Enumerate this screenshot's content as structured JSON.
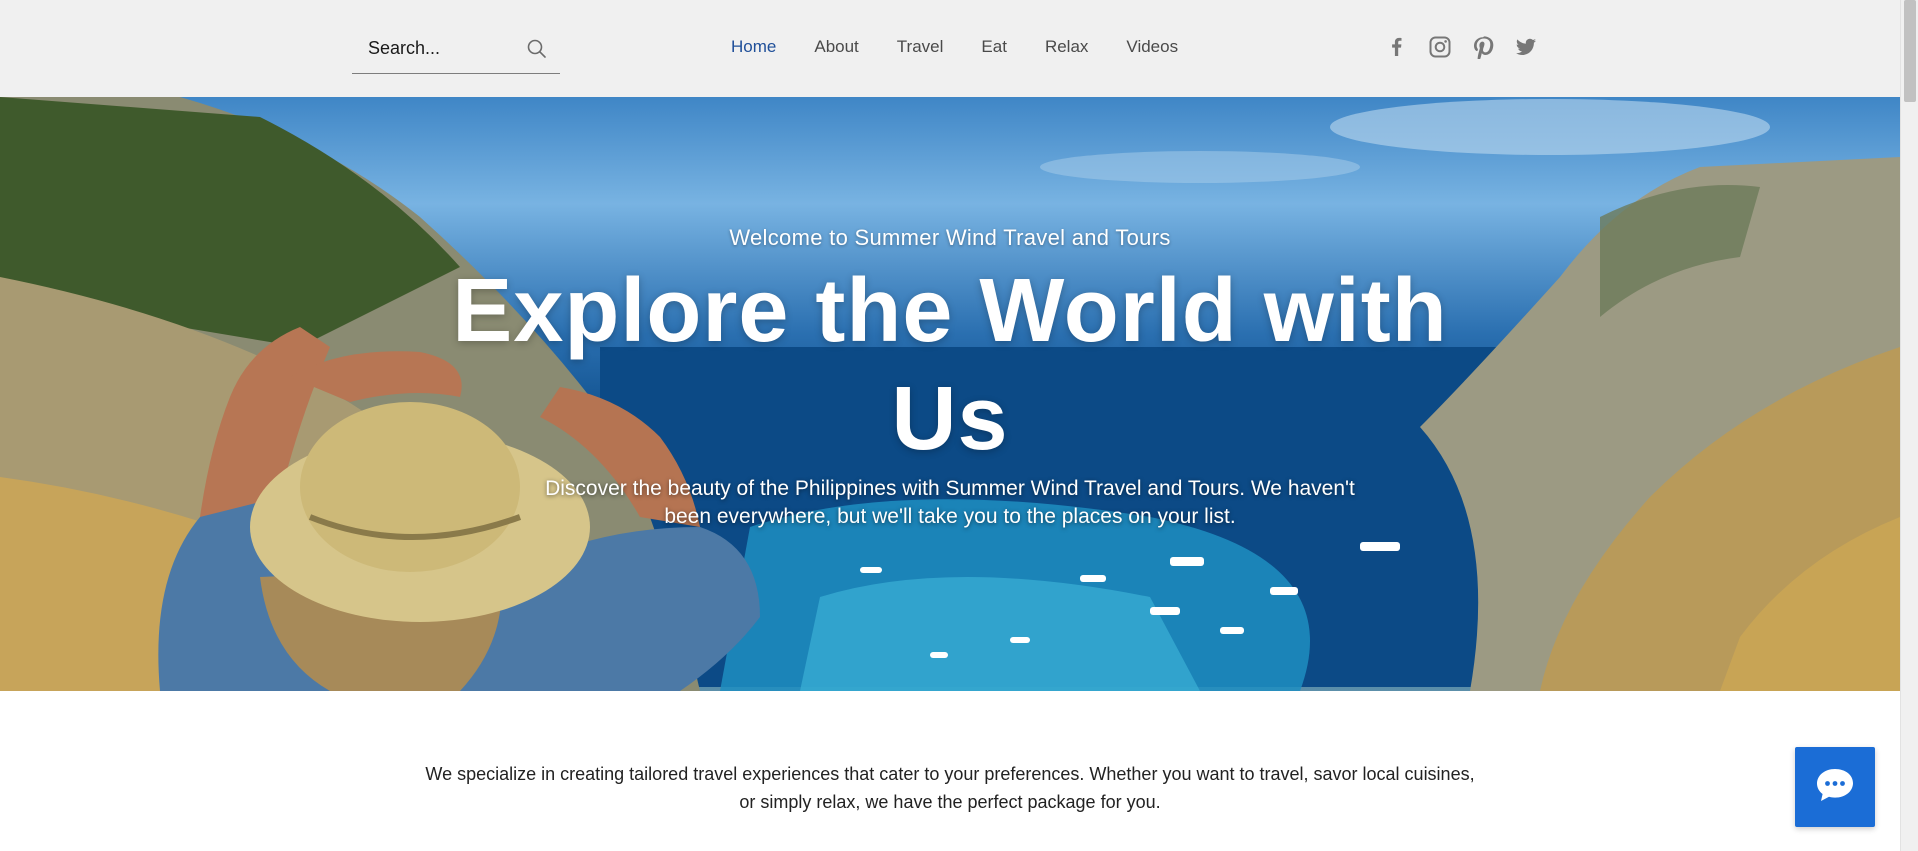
{
  "search": {
    "placeholder": "Search..."
  },
  "nav": {
    "items": [
      {
        "label": "Home",
        "active": true
      },
      {
        "label": "About"
      },
      {
        "label": "Travel"
      },
      {
        "label": "Eat"
      },
      {
        "label": "Relax"
      },
      {
        "label": "Videos"
      }
    ]
  },
  "social": {
    "icons": [
      "facebook-icon",
      "instagram-icon",
      "pinterest-icon",
      "twitter-icon"
    ]
  },
  "hero": {
    "welcome": "Welcome to Summer Wind Travel and Tours",
    "title": "Explore the World with Us",
    "description": "Discover the beauty of the Philippines with Summer Wind Travel and Tours. We haven't been everywhere, but we'll take you to the places on your list."
  },
  "intro": {
    "text": "We specialize in creating tailored travel experiences that cater to your preferences. Whether you want to travel, savor local cuisines, or simply relax, we have the perfect package for you."
  },
  "chat": {
    "icon": "chat-icon"
  },
  "colors": {
    "header_bg": "#f0f0f0",
    "nav_active": "#1f4f99",
    "nav_default": "#4a4a4a",
    "chat_button": "#1b6dd6"
  }
}
